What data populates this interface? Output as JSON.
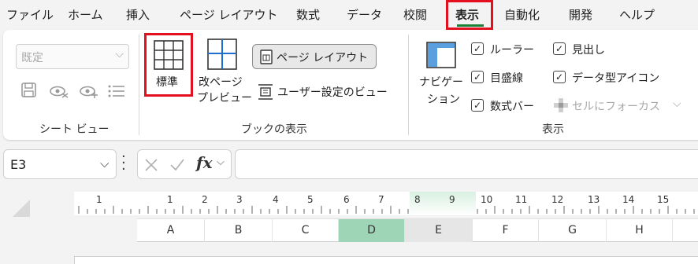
{
  "menu": {
    "items": [
      "ファイル",
      "ホーム",
      "挿入",
      "ページ レイアウト",
      "数式",
      "データ",
      "校閲",
      "表示",
      "自動化",
      "開発",
      "ヘルプ"
    ],
    "active": "表示"
  },
  "ribbon": {
    "sheet_view": {
      "combo_value": "既定",
      "label": "シート ビュー",
      "icons": [
        "save-view-icon",
        "hide-view-icon",
        "new-view-icon",
        "options-list-icon"
      ]
    },
    "workbook_views": {
      "normal_label": "標準",
      "page_break_label_1": "改ページ",
      "page_break_label_2": "プレビュー",
      "page_layout_label": "ページ レイアウト",
      "custom_views_label": "ユーザー設定のビュー",
      "label": "ブックの表示"
    },
    "show": {
      "navigation_label_1": "ナビゲー",
      "navigation_label_2": "ション",
      "ruler": "ルーラー",
      "headings": "見出し",
      "gridlines": "目盛線",
      "data_type_icons": "データ型アイコン",
      "formula_bar": "数式バー",
      "focus_cell": "セルにフォーカス",
      "label": "表示"
    }
  },
  "formula_bar": {
    "name_box": "E3",
    "fx": "fx",
    "value": ""
  },
  "sheet": {
    "columns": [
      "A",
      "B",
      "C",
      "D",
      "E",
      "F",
      "G",
      "H"
    ],
    "selected_column": "D",
    "hover_column": "E",
    "ruler_numbers": [
      "1",
      "1",
      "2",
      "3",
      "4",
      "5",
      "6",
      "7",
      "8",
      "9",
      "10",
      "11",
      "12",
      "13",
      "14",
      "15"
    ]
  },
  "colors": {
    "accent_green": "#1a7f37",
    "highlight_red": "#e5101f",
    "selected_column": "#9fd5b7"
  }
}
